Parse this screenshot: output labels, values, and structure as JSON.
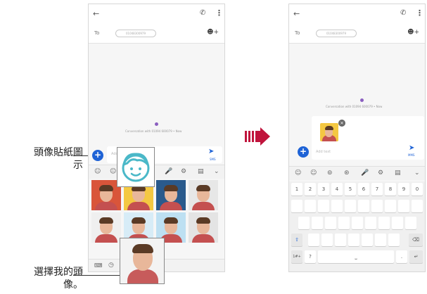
{
  "left_phone": {
    "to_label": "To",
    "recipient_chip": "01048300979",
    "conversation_text": "Conversation with 01094 600079 • Now",
    "input_placeholder": "Add text",
    "send_label": "SMS"
  },
  "right_phone": {
    "to_label": "To",
    "recipient_chip": "01048300979",
    "conversation_text": "Conversation with 01094 600079 • Now",
    "input_placeholder": "Add text",
    "send_label": "MMS",
    "keyboard": {
      "number_row": [
        "1",
        "2",
        "3",
        "4",
        "5",
        "6",
        "7",
        "8",
        "9",
        "0"
      ],
      "symbol_key": "1#+",
      "question_key": "?",
      "period_key": "."
    }
  },
  "callouts": {
    "avatar_sticker_line1": "頭像貼紙圖",
    "avatar_sticker_line2": "示",
    "select_avatar_line1": "選擇我的頭",
    "select_avatar_line2": "像。"
  },
  "colors": {
    "accent_blue": "#1f63d6",
    "arrow_red": "#c0143c",
    "avatar_icon_teal": "#4ab8c8"
  }
}
